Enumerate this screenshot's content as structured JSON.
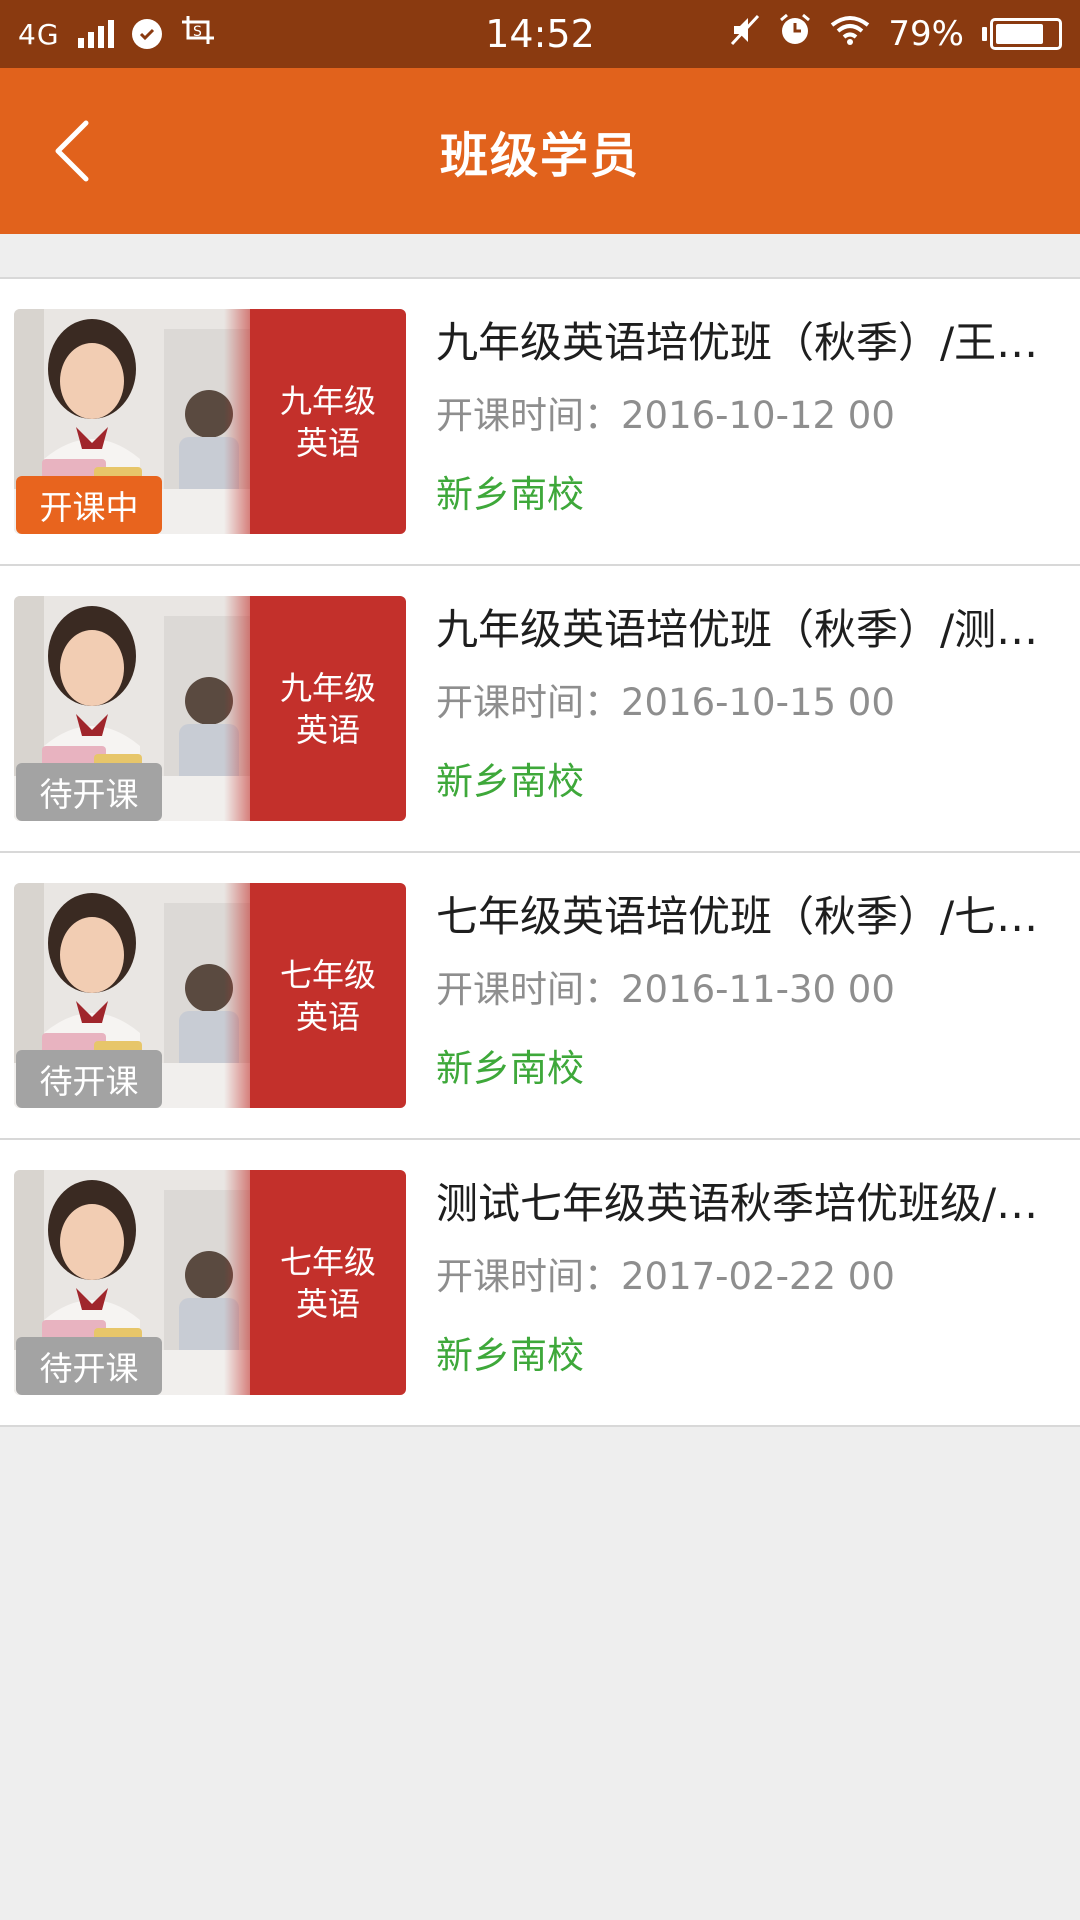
{
  "status_bar": {
    "network": "4G",
    "time": "14:52",
    "battery_percent_text": "79%",
    "battery_level": 0.79
  },
  "header": {
    "title": "班级学员",
    "back_icon": "chevron-left-icon"
  },
  "colors": {
    "header_bg": "#e1621c",
    "status_bg": "#8a3a10",
    "badge_active": "#e8641e",
    "badge_pending": "#a3a3a3",
    "school_text": "#3ea83a",
    "thumb_red": "#c3302b"
  },
  "classes": [
    {
      "thumb_line1": "九年级",
      "thumb_line2": "英语",
      "status": "开课中",
      "status_type": "active",
      "title": "九年级英语培优班（秋季）/王…",
      "start_time": "开课时间：2016-10-12 00",
      "school": "新乡南校"
    },
    {
      "thumb_line1": "九年级",
      "thumb_line2": "英语",
      "status": "待开课",
      "status_type": "pending",
      "title": "九年级英语培优班（秋季）/测…",
      "start_time": "开课时间：2016-10-15 00",
      "school": "新乡南校"
    },
    {
      "thumb_line1": "七年级",
      "thumb_line2": "英语",
      "status": "待开课",
      "status_type": "pending",
      "title": "七年级英语培优班（秋季）/七…",
      "start_time": "开课时间：2016-11-30 00",
      "school": "新乡南校"
    },
    {
      "thumb_line1": "七年级",
      "thumb_line2": "英语",
      "status": "待开课",
      "status_type": "pending",
      "title": "测试七年级英语秋季培优班级/…",
      "start_time": "开课时间：2017-02-22 00",
      "school": "新乡南校"
    }
  ]
}
